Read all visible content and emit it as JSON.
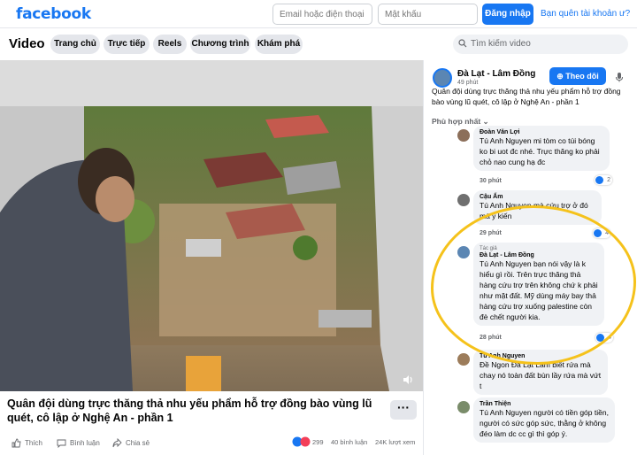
{
  "topbar": {
    "logo": "facebook",
    "email_placeholder": "Email hoặc điện thoại",
    "password_placeholder": "Mật khẩu",
    "login_label": "Đăng nhập",
    "forgot_label": "Bạn quên tài khoản ư?"
  },
  "nav": {
    "title": "Video",
    "tabs": [
      "Trang chủ",
      "Trực tiếp",
      "Reels",
      "Chương trình",
      "Khám phá"
    ],
    "search_placeholder": "Tìm kiếm video"
  },
  "video": {
    "title": "Quân đội dùng trực thăng thả nhu yếu phẩm hỗ trợ đồng bào vùng lũ quét, cô lập ở Nghệ An - phần 1",
    "more_label": "···",
    "actions": {
      "like": "Thích",
      "comment": "Bình luận",
      "share": "Chia sẻ"
    },
    "stats": {
      "reactions": "299",
      "comments": "40 bình luận",
      "views": "24K lượt xem"
    }
  },
  "panel": {
    "page_name": "Đà Lạt - Lâm Đồng",
    "post_time": "49 phút",
    "follow_label": "Theo dõi",
    "post_text": "Quân đội dùng trực thăng thả nhu yếu phẩm hỗ trợ đồng bào vùng lũ quét, cô lập ở Nghệ An - phần 1",
    "sort_label": "Phù hợp nhất ⌄",
    "comments": [
      {
        "name": "Đoàn Văn Lợi",
        "text": "Tú Anh Nguyen mi tòm co túi bóng ko bi uot đc nhé. Trực thăng ko phải chỏ nao cung hạ đc",
        "time": "30 phút",
        "likes": "2"
      },
      {
        "name": "Cậu Ấm",
        "text": "Tú Anh Nguyen mà cứu trợ ở đó mà ý kiến",
        "time": "29 phút",
        "likes": "4"
      },
      {
        "tag": "Tác giả",
        "name": "Đà Lạt - Lâm Đồng",
        "text": "Tú Anh Nguyen bạn nói vậy là k hiểu gì rồi. Trên trực thăng thả hàng cứu trợ trên không chứ k phải như mặt đất. Mỹ dùng máy bay thả hàng cứu trợ xuống palestine còn đè chết người kia.",
        "time": "28 phút",
        "likes": "4"
      },
      {
        "name": "Tú Anh Nguyen",
        "text": "Đề Ngon Đà Lạt Lâm biết rứa mà chay nó toàn đất bùn lầy rứa mà vứt t",
        "time": "",
        "likes": ""
      },
      {
        "name": "Trần Thiện",
        "text": "Tú Anh Nguyen người có tiền góp tiền, người có sức góp sức, thằng ở không đéo làm dc cc gì thì góp ý.",
        "time": "",
        "likes": ""
      }
    ]
  },
  "colors": {
    "brand": "#1877f2",
    "highlight_circle": "#f5c21b"
  }
}
